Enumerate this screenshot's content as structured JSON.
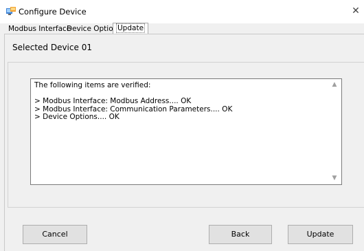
{
  "window": {
    "title": "Configure Device",
    "close_glyph": "✕"
  },
  "tabs": [
    {
      "label": "Modbus Interface",
      "selected": false
    },
    {
      "label": "Device Options",
      "selected": false
    },
    {
      "label": "Update",
      "selected": true
    }
  ],
  "page": {
    "selected_device": "Selected Device 01",
    "verify_text": "The following items are verified:\n\n> Modbus Interface: Modbus Address.... OK\n> Modbus Interface: Communication Parameters.... OK\n> Device Options.... OK"
  },
  "buttons": {
    "cancel": "Cancel",
    "back": "Back",
    "update": "Update"
  },
  "icons": {
    "app": "configure-device-app-icon",
    "close": "close-icon",
    "scroll_up": "scroll-up-arrow-icon",
    "scroll_down": "scroll-down-arrow-icon"
  },
  "colors": {
    "window_bg": "#f0f0f0",
    "titlebar_bg": "#ffffff",
    "button_bg": "#e1e1e1",
    "button_border": "#adadad",
    "textbox_bg": "#ffffff"
  }
}
